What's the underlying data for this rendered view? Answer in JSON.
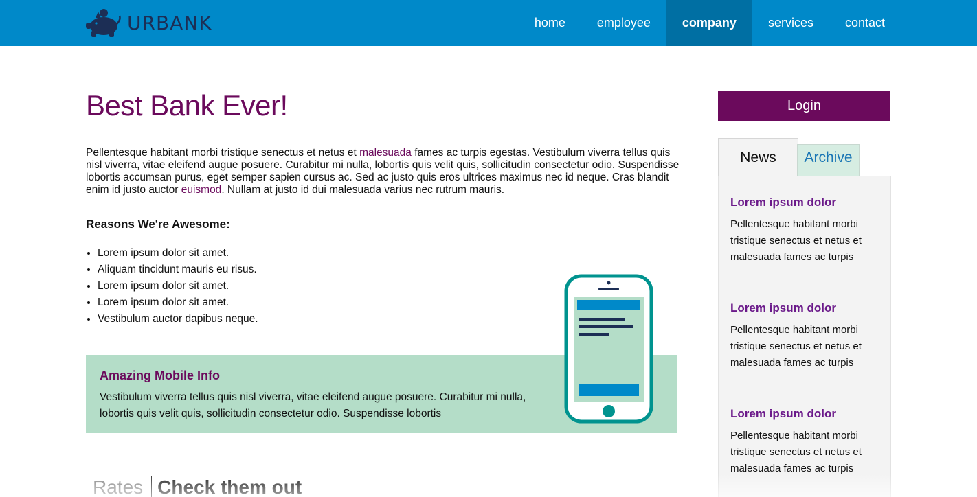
{
  "header": {
    "logo_text": "URBANK",
    "nav": [
      {
        "label": "home",
        "active": false
      },
      {
        "label": "employee",
        "active": false
      },
      {
        "label": "company",
        "active": true
      },
      {
        "label": "services",
        "active": false
      },
      {
        "label": "contact",
        "active": false
      }
    ]
  },
  "main": {
    "title": "Best Bank Ever!",
    "intro": {
      "part1": "Pellentesque habitant morbi tristique senectus et netus et ",
      "link1": "malesuada",
      "part2": " fames ac turpis egestas. Vestibulum viverra tellus quis nisl viverra, vitae eleifend augue posuere. Curabitur mi nulla, lobortis quis velit quis, sollicitudin consectetur odio. Suspendisse lobortis accumsan purus, eget semper sapien cursus ac. Sed ac justo quis eros ultrices maximus nec id neque. Cras blandit enim id justo auctor ",
      "link2": "euismod",
      "part3": ". Nullam at justo id dui malesuada varius nec rutrum mauris."
    },
    "reasons_title": "Reasons We're Awesome:",
    "reasons": [
      "Lorem ipsum dolor sit amet.",
      "Aliquam tincidunt mauris eu risus.",
      "Lorem ipsum dolor sit amet.",
      "Lorem ipsum dolor sit amet.",
      "Vestibulum auctor dapibus neque."
    ],
    "promo": {
      "title": "Amazing Mobile Info",
      "text": "Vestibulum viverra tellus quis nisl viverra, vitae eleifend augue posuere. Curabitur mi nulla, lobortis quis velit quis, sollicitudin consectetur odio. Suspendisse lobortis"
    },
    "rates_label": "Rates",
    "rates_cta": "Check them out"
  },
  "sidebar": {
    "login_label": "Login",
    "tabs": [
      {
        "label": "News",
        "active": true
      },
      {
        "label": "Archive",
        "active": false
      }
    ],
    "news": [
      {
        "title": "Lorem ipsum dolor",
        "text": "Pellentesque habitant morbi tristique senectus et netus et malesuada fames ac turpis"
      },
      {
        "title": "Lorem ipsum dolor",
        "text": "Pellentesque habitant morbi tristique senectus et netus et malesuada fames ac turpis"
      },
      {
        "title": "Lorem ipsum dolor",
        "text": "Pellentesque habitant morbi tristique senectus et netus et malesuada fames ac turpis"
      }
    ]
  },
  "colors": {
    "header_bg": "#0089c9",
    "nav_active_bg": "#006fa3",
    "brand_purple": "#6b0a5c",
    "promo_bg": "#b4ddc8",
    "phone_teal": "#00938f"
  },
  "icons": {
    "logo": "piggy-bank-icon",
    "illustration": "smartphone-icon"
  }
}
